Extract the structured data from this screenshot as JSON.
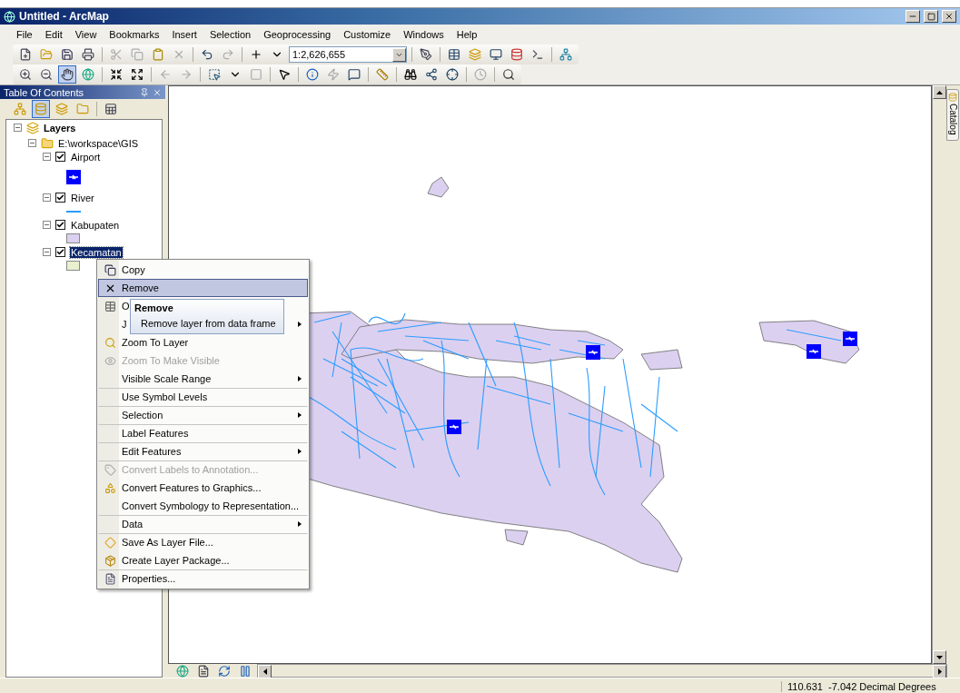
{
  "window": {
    "title": "Untitled - ArcMap"
  },
  "menu": [
    "File",
    "Edit",
    "View",
    "Bookmarks",
    "Insert",
    "Selection",
    "Geoprocessing",
    "Customize",
    "Windows",
    "Help"
  ],
  "scale": {
    "value": "1:2,626,655"
  },
  "toc": {
    "title": "Table Of Contents",
    "root": "Layers",
    "folder": "E:\\workspace\\GIS",
    "layers": [
      {
        "name": "Airport",
        "checked": true,
        "selected": false,
        "kind": "point",
        "color": "#0000ff"
      },
      {
        "name": "River",
        "checked": true,
        "selected": false,
        "kind": "line",
        "color": "#2a9cff"
      },
      {
        "name": "Kabupaten",
        "checked": true,
        "selected": false,
        "kind": "polygon",
        "color": "#dcd0f0"
      },
      {
        "name": "Kecamatan",
        "checked": true,
        "selected": true,
        "kind": "polygon",
        "color": "#e8f0d0"
      }
    ]
  },
  "context_menu": [
    {
      "label": "Copy",
      "selected": false,
      "disabled": false,
      "submenu": false,
      "separator_before": false
    },
    {
      "label": "Remove",
      "selected": true,
      "disabled": false,
      "submenu": false,
      "separator_before": false
    },
    {
      "label": "O",
      "selected": false,
      "disabled": false,
      "submenu": false,
      "separator_before": false
    },
    {
      "label": "J",
      "selected": false,
      "disabled": false,
      "submenu": true,
      "separator_before": false
    },
    {
      "label": "Zoom To Layer",
      "selected": false,
      "disabled": false,
      "submenu": false,
      "separator_before": false
    },
    {
      "label": "Zoom To Make Visible",
      "selected": false,
      "disabled": true,
      "submenu": false,
      "separator_before": false
    },
    {
      "label": "Visible Scale Range",
      "selected": false,
      "disabled": false,
      "submenu": true,
      "separator_before": false
    },
    {
      "label": "Use Symbol Levels",
      "selected": false,
      "disabled": false,
      "submenu": false,
      "separator_before": true
    },
    {
      "label": "Selection",
      "selected": false,
      "disabled": false,
      "submenu": true,
      "separator_before": true
    },
    {
      "label": "Label Features",
      "selected": false,
      "disabled": false,
      "submenu": false,
      "separator_before": true
    },
    {
      "label": "Edit Features",
      "selected": false,
      "disabled": false,
      "submenu": true,
      "separator_before": true
    },
    {
      "label": "Convert Labels to Annotation...",
      "selected": false,
      "disabled": true,
      "submenu": false,
      "separator_before": true
    },
    {
      "label": "Convert Features to Graphics...",
      "selected": false,
      "disabled": false,
      "submenu": false,
      "separator_before": false
    },
    {
      "label": "Convert Symbology to Representation...",
      "selected": false,
      "disabled": false,
      "submenu": false,
      "separator_before": false
    },
    {
      "label": "Data",
      "selected": false,
      "disabled": false,
      "submenu": true,
      "separator_before": true
    },
    {
      "label": "Save As Layer File...",
      "selected": false,
      "disabled": false,
      "submenu": false,
      "separator_before": true
    },
    {
      "label": "Create Layer Package...",
      "selected": false,
      "disabled": false,
      "submenu": false,
      "separator_before": false
    },
    {
      "label": "Properties...",
      "selected": false,
      "disabled": false,
      "submenu": false,
      "separator_before": true
    }
  ],
  "tooltip": {
    "title": "Remove",
    "text": "Remove layer from data frame"
  },
  "catalog_tab": "Catalog",
  "status_bar": {
    "coordinates": "110.631  -7.042 Decimal Degrees"
  }
}
